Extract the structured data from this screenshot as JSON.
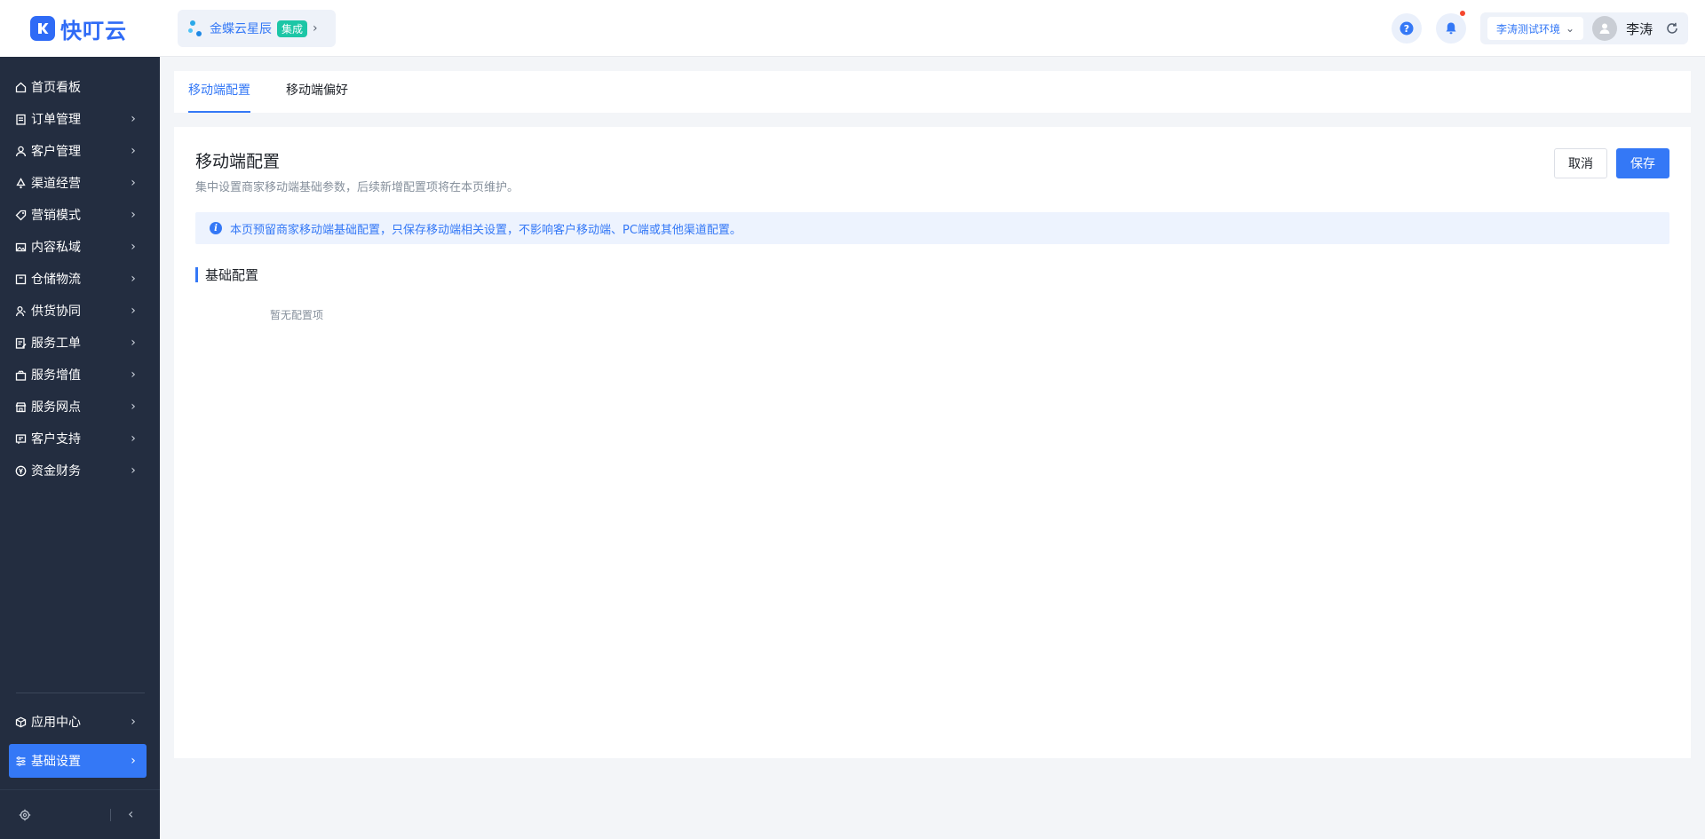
{
  "header": {
    "logo_text": "快叮云",
    "tenant": {
      "name": "金蝶云星辰",
      "badge": "集成"
    },
    "env_select": "李涛测试环境",
    "user_name": "李涛"
  },
  "sidebar": {
    "items": [
      {
        "label": "首页看板",
        "icon": "home-icon",
        "has_arrow": false
      },
      {
        "label": "订单管理",
        "icon": "clipboard-icon",
        "has_arrow": true
      },
      {
        "label": "客户管理",
        "icon": "user-icon",
        "has_arrow": true
      },
      {
        "label": "渠道经营",
        "icon": "recycle-icon",
        "has_arrow": true
      },
      {
        "label": "营销模式",
        "icon": "tag-icon",
        "has_arrow": true
      },
      {
        "label": "内容私域",
        "icon": "image-icon",
        "has_arrow": true
      },
      {
        "label": "仓储物流",
        "icon": "box-icon",
        "has_arrow": true
      },
      {
        "label": "供货协同",
        "icon": "user-group-icon",
        "has_arrow": true
      },
      {
        "label": "服务工单",
        "icon": "document-edit-icon",
        "has_arrow": true
      },
      {
        "label": "服务增值",
        "icon": "gift-icon",
        "has_arrow": true
      },
      {
        "label": "服务网点",
        "icon": "store-icon",
        "has_arrow": true
      },
      {
        "label": "客户支持",
        "icon": "support-card-icon",
        "has_arrow": true
      },
      {
        "label": "资金财务",
        "icon": "yen-icon",
        "has_arrow": true
      }
    ],
    "bottom_items": [
      {
        "label": "应用中心",
        "icon": "cube-icon",
        "has_arrow": true
      },
      {
        "label": "基础设置",
        "icon": "sliders-icon",
        "has_arrow": true,
        "active": true
      }
    ]
  },
  "tabs": [
    {
      "label": "移动端配置",
      "active": true
    },
    {
      "label": "移动端偏好",
      "active": false
    }
  ],
  "main": {
    "title": "移动端配置",
    "description": "集中设置商家移动端基础参数，后续新增配置项将在本页维护。",
    "cancel_label": "取消",
    "save_label": "保存",
    "notice": "本页预留商家移动端基础配置，只保存移动端相关设置，不影响客户移动端、PC端或其他渠道配置。",
    "section_title": "基础配置",
    "empty_text": "暂无配置项"
  },
  "colors": {
    "primary": "#3478f6",
    "sidebar_bg": "#232d40",
    "badge_green": "#1cc6a6",
    "notification_dot": "#f5472e"
  }
}
